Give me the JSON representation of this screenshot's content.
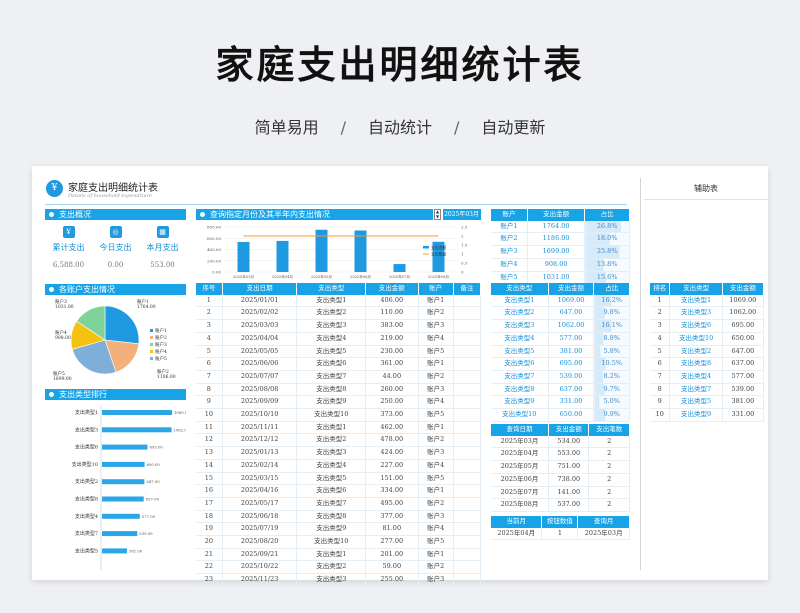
{
  "page": {
    "title": "家庭支出明细统计表",
    "tags": [
      "简单易用",
      "自动统计",
      "自动更新"
    ],
    "sep": "/"
  },
  "sheet": {
    "title": "家庭支出明细统计表",
    "subtitle": "Details of household expenditure",
    "logo": "¥",
    "aux_title": "辅助表"
  },
  "overview": {
    "header": "支出概况",
    "items": [
      {
        "label": "累计支出",
        "value": "6,588.00",
        "icon": "wallet-icon"
      },
      {
        "label": "今日支出",
        "value": "0.00",
        "icon": "coins-icon"
      },
      {
        "label": "本月支出",
        "value": "553.00",
        "icon": "calendar-icon"
      }
    ]
  },
  "pie": {
    "header": "各账户支出情况",
    "labels": [
      {
        "t": "账户1",
        "v": "1764.00"
      },
      {
        "t": "账户2",
        "v": "1186.00"
      },
      {
        "t": "账户3",
        "v": "1031.00"
      },
      {
        "t": "账户4",
        "v": "908.00"
      },
      {
        "t": "账户5",
        "v": "1699.00"
      }
    ],
    "legend": [
      "账户1",
      "账户2",
      "账户3",
      "账户4",
      "账户5"
    ],
    "colors": [
      "#1f9ae0",
      "#f4b07a",
      "#7fd39a",
      "#f5c211",
      "#7faed8"
    ]
  },
  "rank": {
    "header": "支出类型排行",
    "items": [
      {
        "name": "支出类型1",
        "v": 1069
      },
      {
        "name": "支出类型3",
        "v": 1062
      },
      {
        "name": "支出类型6",
        "v": 695
      },
      {
        "name": "支出类型10",
        "v": 650
      },
      {
        "name": "支出类型2",
        "v": 647
      },
      {
        "name": "支出类型8",
        "v": 637
      },
      {
        "name": "支出类型4",
        "v": 577
      },
      {
        "name": "支出类型7",
        "v": 539
      },
      {
        "name": "支出类型5",
        "v": 381
      }
    ],
    "labels": [
      "1069.00",
      "1062.00",
      "695.00",
      "650.00",
      "647.00",
      "637.00",
      "577.00",
      "539.00",
      "381.00"
    ]
  },
  "query": {
    "header": "查询指定月份及其半年内支出情况",
    "month": "2025年03月"
  },
  "chart_data": {
    "type": "bar",
    "categories": [
      "2025年03月",
      "2025年04月",
      "2025年05月",
      "2025年06月",
      "2025年07月",
      "2025年08月"
    ],
    "series": [
      {
        "name": "支出金额",
        "type": "bar",
        "values": [
          534,
          553,
          751,
          738,
          141,
          537
        ],
        "color": "#1f9ae0"
      },
      {
        "name": "支出数量",
        "type": "line",
        "values": [
          2,
          2,
          2,
          2,
          2,
          2
        ],
        "color": "#f29a3a"
      }
    ],
    "ylim": [
      0,
      800
    ],
    "yticks": [
      "800.00",
      "600.00",
      "400.00",
      "200.00",
      "0.00"
    ],
    "y2lim": [
      0,
      2.5
    ],
    "y2ticks": [
      "2.5",
      "2",
      "1.5",
      "1",
      "0.5",
      "0"
    ]
  },
  "detail": {
    "headers": [
      "序号",
      "支出日期",
      "支出类型",
      "支出金额",
      "账户",
      "备注"
    ],
    "rows": [
      [
        "1",
        "2025/01/01",
        "支出类型1",
        "406.00",
        "账户1",
        ""
      ],
      [
        "2",
        "2025/02/02",
        "支出类型2",
        "110.00",
        "账户2",
        ""
      ],
      [
        "3",
        "2025/03/03",
        "支出类型3",
        "383.00",
        "账户3",
        ""
      ],
      [
        "4",
        "2025/04/04",
        "支出类型4",
        "219.00",
        "账户4",
        ""
      ],
      [
        "5",
        "2025/05/05",
        "支出类型5",
        "230.00",
        "账户5",
        ""
      ],
      [
        "6",
        "2025/06/06",
        "支出类型6",
        "361.00",
        "账户1",
        ""
      ],
      [
        "7",
        "2025/07/07",
        "支出类型7",
        "44.00",
        "账户2",
        ""
      ],
      [
        "8",
        "2025/08/08",
        "支出类型8",
        "260.00",
        "账户3",
        ""
      ],
      [
        "9",
        "2025/09/09",
        "支出类型9",
        "250.00",
        "账户4",
        ""
      ],
      [
        "10",
        "2025/10/10",
        "支出类型10",
        "373.00",
        "账户5",
        ""
      ],
      [
        "11",
        "2025/11/11",
        "支出类型1",
        "462.00",
        "账户1",
        ""
      ],
      [
        "12",
        "2025/12/12",
        "支出类型2",
        "478.00",
        "账户2",
        ""
      ],
      [
        "13",
        "2025/01/13",
        "支出类型3",
        "424.00",
        "账户3",
        ""
      ],
      [
        "14",
        "2025/02/14",
        "支出类型4",
        "227.00",
        "账户4",
        ""
      ],
      [
        "15",
        "2025/03/15",
        "支出类型5",
        "151.00",
        "账户5",
        ""
      ],
      [
        "16",
        "2025/04/16",
        "支出类型6",
        "334.00",
        "账户1",
        ""
      ],
      [
        "17",
        "2025/05/17",
        "支出类型7",
        "495.00",
        "账户2",
        ""
      ],
      [
        "18",
        "2025/06/18",
        "支出类型8",
        "377.00",
        "账户3",
        ""
      ],
      [
        "19",
        "2025/07/19",
        "支出类型9",
        "81.00",
        "账户4",
        ""
      ],
      [
        "20",
        "2025/08/20",
        "支出类型10",
        "277.00",
        "账户5",
        ""
      ],
      [
        "21",
        "2025/09/21",
        "支出类型1",
        "201.00",
        "账户1",
        ""
      ],
      [
        "22",
        "2025/10/22",
        "支出类型2",
        "59.00",
        "账户2",
        ""
      ],
      [
        "23",
        "2025/11/23",
        "支出类型3",
        "255.00",
        "账户3",
        ""
      ]
    ]
  },
  "accounts": {
    "headers": [
      "账户",
      "支出金额",
      "占比"
    ],
    "rows": [
      [
        "账户1",
        "1764.00",
        "26.8%",
        26.8
      ],
      [
        "账户2",
        "1186.00",
        "18.0%",
        18.0
      ],
      [
        "账户3",
        "1699.00",
        "25.8%",
        25.8
      ],
      [
        "账户4",
        "908.00",
        "13.8%",
        13.8
      ],
      [
        "账户5",
        "1031.00",
        "15.6%",
        15.6
      ]
    ]
  },
  "types": {
    "headers": [
      "支出类型",
      "支出金额",
      "占比"
    ],
    "rows": [
      [
        "支出类型1",
        "1069.00",
        "16.2%",
        16.2
      ],
      [
        "支出类型2",
        "647.00",
        "9.8%",
        9.8
      ],
      [
        "支出类型3",
        "1062.00",
        "16.1%",
        16.1
      ],
      [
        "支出类型4",
        "577.00",
        "8.8%",
        8.8
      ],
      [
        "支出类型5",
        "381.00",
        "5.8%",
        5.8
      ],
      [
        "支出类型6",
        "695.00",
        "10.5%",
        10.5
      ],
      [
        "支出类型7",
        "539.00",
        "8.2%",
        8.2
      ],
      [
        "支出类型8",
        "637.00",
        "9.7%",
        9.7
      ],
      [
        "支出类型9",
        "331.00",
        "5.0%",
        5.0
      ],
      [
        "支出类型10",
        "650.00",
        "9.9%",
        9.9
      ]
    ]
  },
  "monthly": {
    "headers": [
      "查询日期",
      "支出金额",
      "支出笔数"
    ],
    "rows": [
      [
        "2025年03月",
        "534.00",
        "2"
      ],
      [
        "2025年04月",
        "553.00",
        "2"
      ],
      [
        "2025年05月",
        "751.00",
        "2"
      ],
      [
        "2025年06月",
        "738.00",
        "2"
      ],
      [
        "2025年07月",
        "141.00",
        "2"
      ],
      [
        "2025年08月",
        "537.00",
        "2"
      ]
    ]
  },
  "current": {
    "headers": [
      "当前月",
      "按钮数值",
      "查询月"
    ],
    "row": [
      "2025年04月",
      "1",
      "2025年03月"
    ]
  },
  "aux": {
    "headers": [
      "排名",
      "支出类型",
      "支出金额"
    ],
    "rows": [
      [
        "1",
        "支出类型1",
        "1069.00"
      ],
      [
        "2",
        "支出类型3",
        "1062.00"
      ],
      [
        "3",
        "支出类型6",
        "695.00"
      ],
      [
        "4",
        "支出类型10",
        "650.00"
      ],
      [
        "5",
        "支出类型2",
        "647.00"
      ],
      [
        "6",
        "支出类型8",
        "637.00"
      ],
      [
        "7",
        "支出类型4",
        "577.00"
      ],
      [
        "8",
        "支出类型7",
        "539.00"
      ],
      [
        "9",
        "支出类型5",
        "381.00"
      ],
      [
        "10",
        "支出类型9",
        "331.00"
      ]
    ]
  }
}
